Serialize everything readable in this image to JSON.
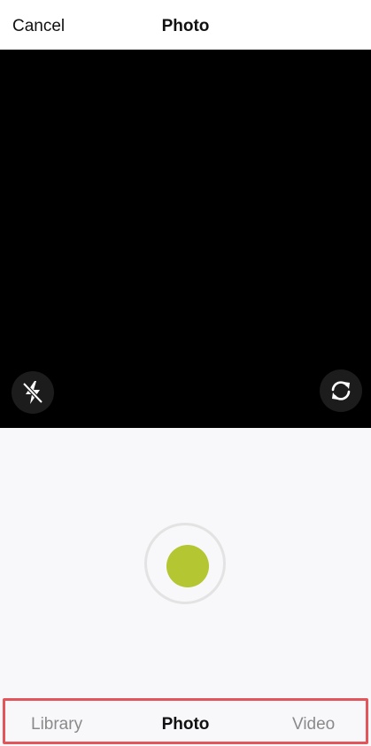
{
  "header": {
    "cancel_label": "Cancel",
    "title": "Photo"
  },
  "camera": {
    "flash_icon": "flash-off-icon",
    "flip_icon": "switch-camera-icon",
    "shutter_color": "#b4c631"
  },
  "tabs": [
    {
      "label": "Library",
      "selected": false
    },
    {
      "label": "Photo",
      "selected": true
    },
    {
      "label": "Video",
      "selected": false
    }
  ],
  "colors": {
    "highlight_border": "#e2555b",
    "inactive_tab": "#8a8a8a",
    "active_tab": "#111111"
  }
}
